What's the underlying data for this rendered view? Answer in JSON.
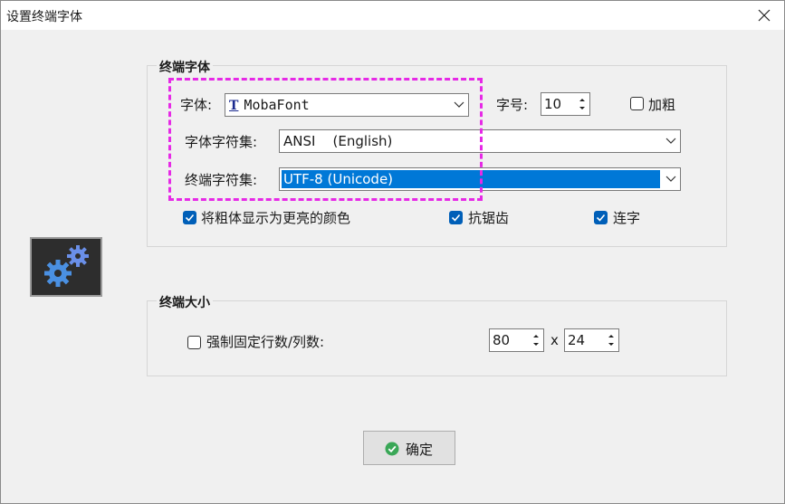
{
  "window": {
    "title": "设置终端字体",
    "close_icon": "close-icon"
  },
  "font_group": {
    "legend": "终端字体",
    "font_label": "字体:",
    "font_value": "MobaFont",
    "font_type_icon": "T",
    "size_label": "字号:",
    "size_value": "10",
    "bold_label": "加粗",
    "bold_checked": false,
    "charset_label": "字体字符集:",
    "charset_value": "ANSI    (English)",
    "terminal_charset_label": "终端字符集:",
    "terminal_charset_value": "UTF-8 (Unicode)",
    "bright_bold_label": "将粗体显示为更亮的颜色",
    "bright_bold_checked": true,
    "antialias_label": "抗锯齿",
    "antialias_checked": true,
    "ligature_label": "连字",
    "ligature_checked": true
  },
  "size_group": {
    "legend": "终端大小",
    "force_label": "强制固定行数/列数:",
    "force_checked": false,
    "cols_value": "80",
    "times": "x",
    "rows_value": "24"
  },
  "ok_button": {
    "label": "确定",
    "icon": "check-circle-icon"
  },
  "colors": {
    "accent": "#005fb8",
    "selection": "#0078d7",
    "annotation": "#e629e6",
    "ok_icon": "#3aa757"
  }
}
